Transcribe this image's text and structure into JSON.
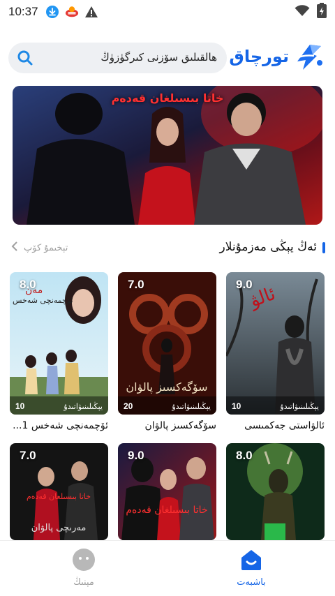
{
  "status_bar": {
    "time": "10:37"
  },
  "header": {
    "brand_name": "تورچاق",
    "search_placeholder": "ھالقىلىق سۆزنى كىرگۈزۈڭ"
  },
  "banner": {
    "title": "خاتا بىسىلغان قەدەم"
  },
  "section": {
    "title": "ئەڭ يېڭى مەزمۇنلار",
    "more_label": "تېخىمۇ كۆپ"
  },
  "cards": [
    {
      "title": "ئالۋاستى جەكمىسى",
      "score": "9.0",
      "episodes": "10",
      "status": "يېڭىلىنىۋاتىدۇ"
    },
    {
      "title": "سۆگەكسىز پالۋان",
      "score": "7.0",
      "episodes": "20",
      "status": "يېڭىلىنىۋاتىدۇ"
    },
    {
      "title": "ئۆچمەنچى شەخس 1...",
      "score": "8.0",
      "episodes": "10",
      "status": "يېڭىلىنىۋاتىدۇ"
    },
    {
      "title": "",
      "score": "8.0",
      "episodes": "",
      "status": ""
    },
    {
      "title": "",
      "score": "9.0",
      "episodes": "",
      "status": ""
    },
    {
      "title": "",
      "score": "7.0",
      "episodes": "",
      "status": ""
    }
  ],
  "bottom_nav": {
    "home_label": "باشبەت",
    "mine_label": "مېنىڭ"
  },
  "colors": {
    "accent": "#1565e6",
    "muted": "#a0a0a0"
  }
}
